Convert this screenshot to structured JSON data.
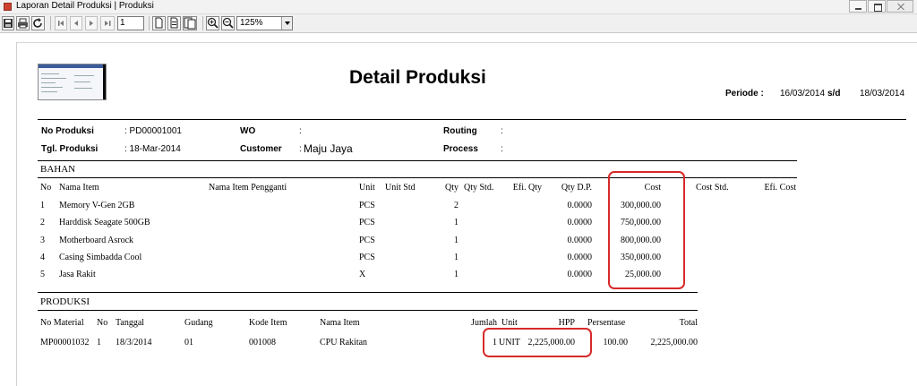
{
  "window": {
    "title": "Laporan Detail Produksi | Produksi"
  },
  "toolbar": {
    "page": "1",
    "zoom": "125%"
  },
  "report": {
    "title": "Detail Produksi",
    "periode_label": "Periode :",
    "periode_from": "16/03/2014",
    "periode_sd": "s/d",
    "periode_to": "18/03/2014"
  },
  "header": {
    "no_produksi_label": "No Produksi",
    "no_produksi_value": ": PD00001001",
    "tgl_produksi_label": "Tgl. Produksi",
    "tgl_produksi_value": ": 18-Mar-2014",
    "wo_label": "WO",
    "wo_value": ":",
    "customer_label": "Customer",
    "customer_colon": ":",
    "customer_value": "Maju Jaya",
    "routing_label": "Routing",
    "routing_value": ":",
    "process_label": "Process",
    "process_value": ":"
  },
  "bahan": {
    "section": "BAHAN",
    "columns": {
      "no": "No",
      "nama_item": "Nama Item",
      "pengganti": "Nama Item Pengganti",
      "unit": "Unit",
      "unit_std": "Unit Std",
      "qty": "Qty",
      "qty_std": "Qty Std.",
      "efi_qty": "Efi. Qty",
      "qty_dp": "Qty D.P.",
      "cost": "Cost",
      "cost_std": "Cost Std.",
      "efi_cost": "Efi. Cost"
    },
    "rows": [
      {
        "no": "1",
        "nama": "Memory V-Gen 2GB",
        "unit": "PCS",
        "qty": "2",
        "qty_dp": "0.0000",
        "cost": "300,000.00"
      },
      {
        "no": "2",
        "nama": "Harddisk Seagate 500GB",
        "unit": "PCS",
        "qty": "1",
        "qty_dp": "0.0000",
        "cost": "750,000.00"
      },
      {
        "no": "3",
        "nama": "Motherboard Asrock",
        "unit": "PCS",
        "qty": "1",
        "qty_dp": "0.0000",
        "cost": "800,000.00"
      },
      {
        "no": "4",
        "nama": "Casing Simbadda Cool",
        "unit": "PCS",
        "qty": "1",
        "qty_dp": "0.0000",
        "cost": "350,000.00"
      },
      {
        "no": "5",
        "nama": "Jasa Rakit",
        "unit": "X",
        "qty": "1",
        "qty_dp": "0.0000",
        "cost": "25,000.00"
      }
    ]
  },
  "produksi": {
    "section": "PRODUKSI",
    "columns": {
      "no_material": "No Material",
      "no": "No",
      "tanggal": "Tanggal",
      "gudang": "Gudang",
      "kode_item": "Kode Item",
      "nama_item": "Nama Item",
      "jumlah": "Jumlah",
      "unit": "Unit",
      "hpp": "HPP",
      "persentase": "Persentase",
      "total": "Total"
    },
    "row": {
      "no_material": "MP00001032",
      "no": "1",
      "tanggal": "18/3/2014",
      "gudang": "01",
      "kode_item": "001008",
      "nama_item": "CPU Rakitan",
      "jumlah": "1",
      "unit": "UNIT",
      "hpp": "2,225,000.00",
      "persentase": "100.00",
      "total": "2,225,000.00"
    }
  },
  "colors": {
    "highlight": "#d62a2a"
  }
}
